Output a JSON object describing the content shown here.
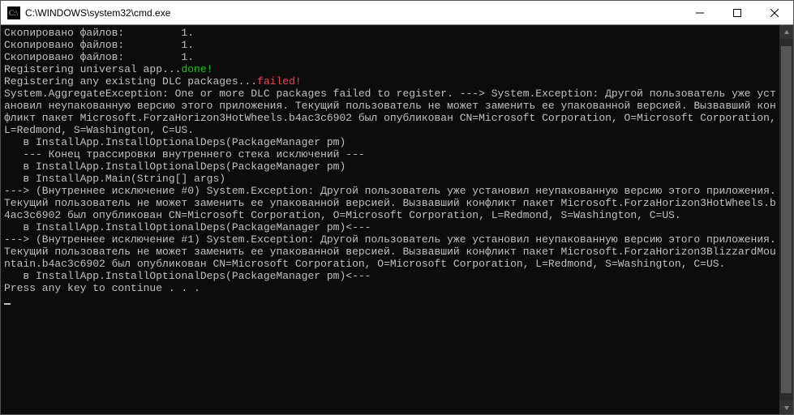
{
  "window": {
    "title": "C:\\WINDOWS\\system32\\cmd.exe"
  },
  "lines": [
    {
      "segs": [
        {
          "t": "Скопировано файлов:         1."
        }
      ]
    },
    {
      "segs": [
        {
          "t": "Скопировано файлов:         1."
        }
      ]
    },
    {
      "segs": [
        {
          "t": "Скопировано файлов:         1."
        }
      ]
    },
    {
      "segs": [
        {
          "t": "Registering universal app..."
        },
        {
          "t": "done!",
          "c": "green"
        }
      ]
    },
    {
      "segs": [
        {
          "t": "Registering any existing DLC packages..."
        },
        {
          "t": "failed!",
          "c": "red"
        }
      ]
    },
    {
      "segs": [
        {
          "t": "System.AggregateException: One or more DLC packages failed to register. ---> System.Exception: Другой пользователь уже установил неупакованную версию этого приложения. Текущий пользователь не может заменить ее упакованной версией. Вызвавший конфликт пакет Microsoft.ForzaHorizon3HotWheels.b4ac3c6902 был опубликован CN=Microsoft Corporation, O=Microsoft Corporation, L=Redmond, S=Washington, C=US."
        }
      ]
    },
    {
      "segs": [
        {
          "t": "   в InstallApp.InstallOptionalDeps(PackageManager pm)"
        }
      ]
    },
    {
      "segs": [
        {
          "t": "   --- Конец трассировки внутреннего стека исключений ---"
        }
      ]
    },
    {
      "segs": [
        {
          "t": "   в InstallApp.InstallOptionalDeps(PackageManager pm)"
        }
      ]
    },
    {
      "segs": [
        {
          "t": "   в InstallApp.Main(String[] args)"
        }
      ]
    },
    {
      "segs": [
        {
          "t": "---> (Внутреннее исключение #0) System.Exception: Другой пользователь уже установил неупакованную версию этого приложения. Текущий пользователь не может заменить ее упакованной версией. Вызвавший конфликт пакет Microsoft.ForzaHorizon3HotWheels.b4ac3c6902 был опубликован CN=Microsoft Corporation, O=Microsoft Corporation, L=Redmond, S=Washington, C=US."
        }
      ]
    },
    {
      "segs": [
        {
          "t": "   в InstallApp.InstallOptionalDeps(PackageManager pm)<---"
        }
      ]
    },
    {
      "segs": [
        {
          "t": ""
        }
      ]
    },
    {
      "segs": [
        {
          "t": "---> (Внутреннее исключение #1) System.Exception: Другой пользователь уже установил неупакованную версию этого приложения. Текущий пользователь не может заменить ее упакованной версией. Вызвавший конфликт пакет Microsoft.ForzaHorizon3BlizzardMountain.b4ac3c6902 был опубликован CN=Microsoft Corporation, O=Microsoft Corporation, L=Redmond, S=Washington, C=US."
        }
      ]
    },
    {
      "segs": [
        {
          "t": "   в InstallApp.InstallOptionalDeps(PackageManager pm)<---"
        }
      ]
    },
    {
      "segs": [
        {
          "t": ""
        }
      ]
    },
    {
      "segs": [
        {
          "t": "Press any key to continue . . ."
        }
      ]
    }
  ],
  "scrollbar": {
    "thumb_top_pct": 2,
    "thumb_height_pct": 96
  }
}
